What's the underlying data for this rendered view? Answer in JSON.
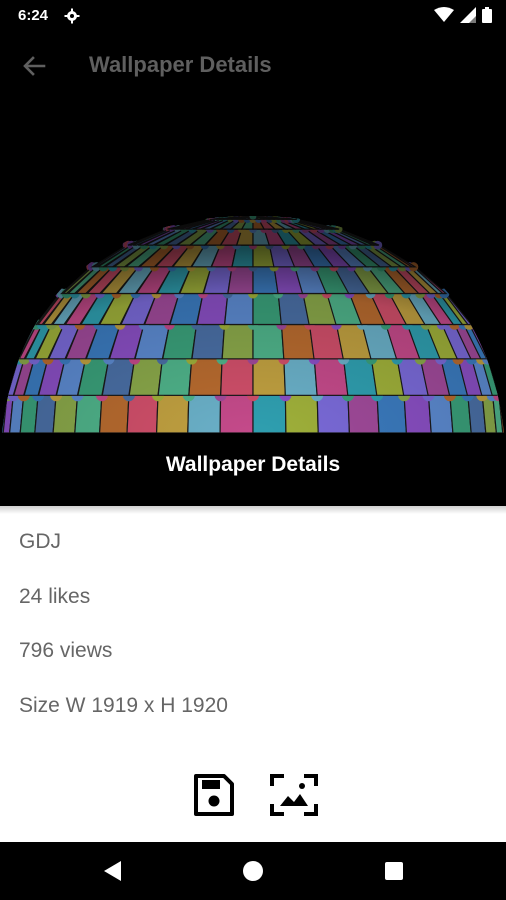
{
  "status_bar": {
    "time": "6:24",
    "icons": [
      "gear-icon",
      "wifi-icon",
      "signal-icon",
      "battery-icon"
    ]
  },
  "app_bar": {
    "title": "Wallpaper Details",
    "back_icon": "arrow-left-icon"
  },
  "hero": {
    "caption": "Wallpaper Details"
  },
  "details": {
    "author": "GDJ",
    "likes": "24 likes",
    "views": "796 views",
    "size": "Size W 1919 x H 1920"
  },
  "actions": {
    "save_icon": "floppy-disk-icon",
    "set_wallpaper_icon": "set-wallpaper-icon"
  },
  "nav_bar": {
    "icons": [
      "back-triangle-icon",
      "home-circle-icon",
      "recents-square-icon"
    ]
  },
  "colors": {
    "background": "#000000",
    "app_title": "#5f5f5f",
    "detail_text": "#666666",
    "surface": "#ffffff"
  }
}
